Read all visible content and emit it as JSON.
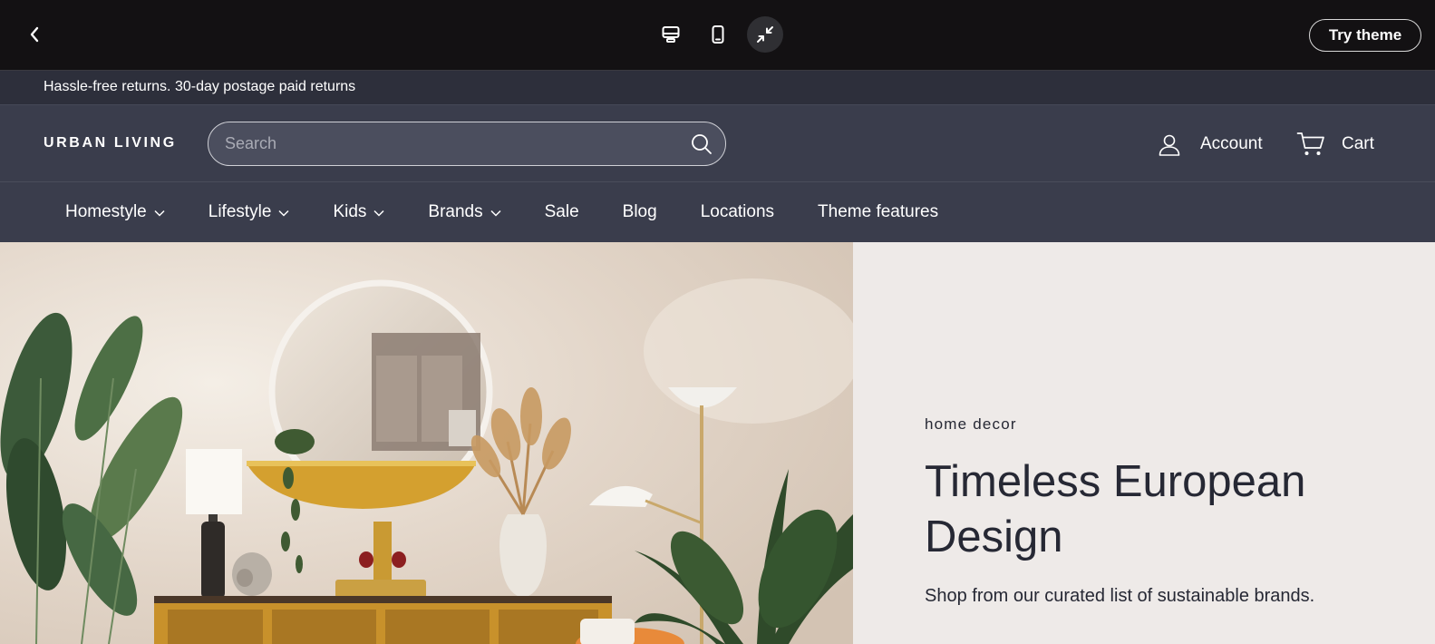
{
  "preview_bar": {
    "try_theme_label": "Try theme",
    "icons": [
      "back-chevron-icon",
      "desktop-icon",
      "mobile-icon",
      "collapse-icon"
    ]
  },
  "announcement": {
    "text": "Hassle-free returns. 30-day postage paid returns"
  },
  "header": {
    "logo": "URBAN LIVING",
    "search_placeholder": "Search",
    "account_label": "Account",
    "cart_label": "Cart"
  },
  "nav": {
    "items": [
      {
        "label": "Homestyle",
        "has_dropdown": true
      },
      {
        "label": "Lifestyle",
        "has_dropdown": true
      },
      {
        "label": "Kids",
        "has_dropdown": true
      },
      {
        "label": "Brands",
        "has_dropdown": true
      },
      {
        "label": "Sale",
        "has_dropdown": false
      },
      {
        "label": "Blog",
        "has_dropdown": false
      },
      {
        "label": "Locations",
        "has_dropdown": false
      },
      {
        "label": "Theme features",
        "has_dropdown": false
      }
    ]
  },
  "hero": {
    "eyebrow": "home decor",
    "title": "Timeless European Design",
    "subtitle": "Shop from our curated list of sustainable brands."
  },
  "colors": {
    "toolbar_bg": "#131113",
    "announcement_bg": "#2d2f3b",
    "header_bg": "#3a3d4c",
    "hero_panel_bg": "#eeeae8",
    "text_dark": "#262834"
  }
}
